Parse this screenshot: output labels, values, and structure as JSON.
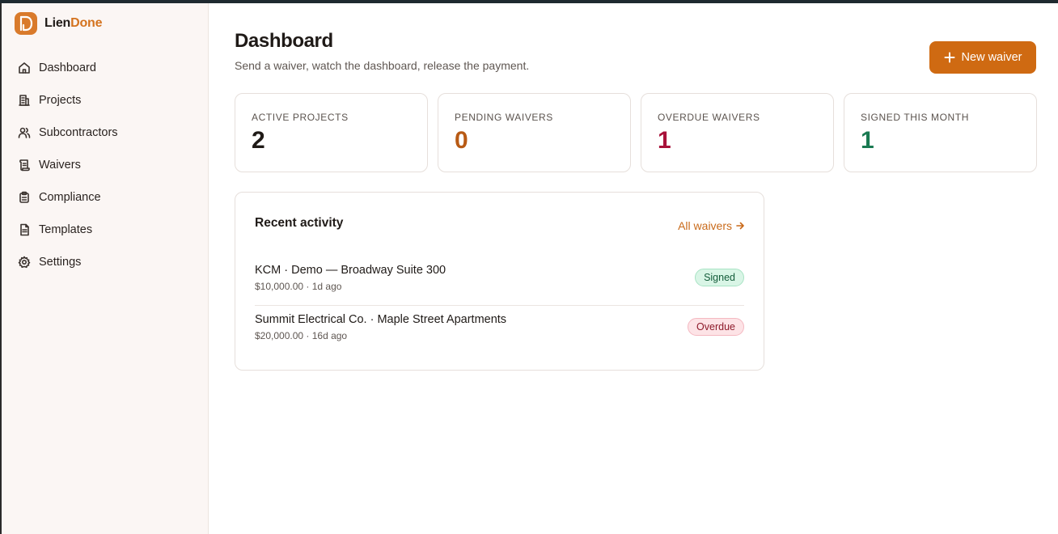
{
  "brand": {
    "name_a": "Lien",
    "name_b": "Done"
  },
  "colors": {
    "accent": "#cf6a12",
    "stat_default": "#1f1a17",
    "stat_pending": "#b85a14",
    "stat_overdue": "#a8123a",
    "stat_signed": "#1a7a52",
    "signed_bg": "#d9f5e6",
    "signed_border": "#a8e3c4",
    "signed_text": "#145c3a",
    "overdue_bg": "#fde3e6",
    "overdue_border": "#f4b8c1",
    "overdue_text": "#8d1a2a"
  },
  "sidebar": {
    "items": [
      {
        "label": "Dashboard",
        "icon": "home-icon"
      },
      {
        "label": "Projects",
        "icon": "building-icon"
      },
      {
        "label": "Subcontractors",
        "icon": "users-icon"
      },
      {
        "label": "Waivers",
        "icon": "scroll-icon"
      },
      {
        "label": "Compliance",
        "icon": "clipboard-icon"
      },
      {
        "label": "Templates",
        "icon": "file-icon"
      },
      {
        "label": "Settings",
        "icon": "gear-icon"
      }
    ]
  },
  "header": {
    "title": "Dashboard",
    "subtitle": "Send a waiver, watch the dashboard, release the payment.",
    "new_button": "New waiver"
  },
  "stats": [
    {
      "label": "ACTIVE PROJECTS",
      "value": "2"
    },
    {
      "label": "PENDING WAIVERS",
      "value": "0"
    },
    {
      "label": "OVERDUE WAIVERS",
      "value": "1"
    },
    {
      "label": "SIGNED THIS MONTH",
      "value": "1"
    }
  ],
  "activity": {
    "title": "Recent activity",
    "link": "All waivers",
    "rows": [
      {
        "title": "KCM · Demo — Broadway Suite 300",
        "meta": "$10,000.00 · 1d ago",
        "status": "Signed"
      },
      {
        "title": "Summit Electrical Co. · Maple Street Apartments",
        "meta": "$20,000.00 · 16d ago",
        "status": "Overdue"
      }
    ]
  }
}
